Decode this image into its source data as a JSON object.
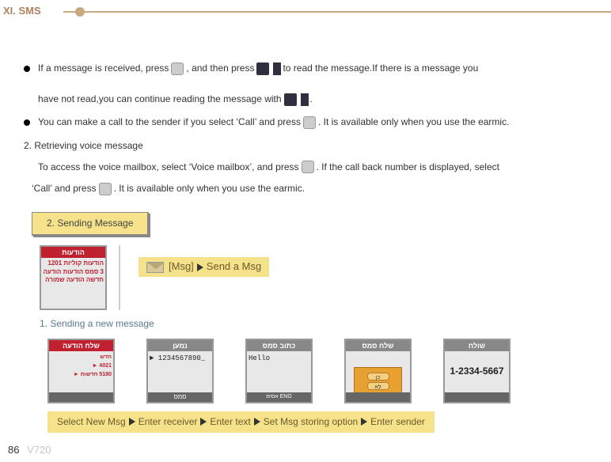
{
  "header": {
    "chapter": "XI. SMS"
  },
  "body": {
    "bullet1_a": "If a message is received, press ",
    "bullet1_b": " , and then press ",
    "bullet1_c": " to read the message.If there is a message you",
    "bullet1_cont_a": "have not read,you can continue reading the message with ",
    "bullet1_cont_b": " .",
    "bullet2_a": "You can make a call to the sender if you select ‘Call’ and press ",
    "bullet2_b": " . It is available only when you use the earmic.",
    "section2": "2. Retrieving voice message",
    "section2_line1_a": "To access the voice mailbox, select ‘Voice mailbox’, and press ",
    "section2_line1_b": " . If the call back number is displayed, select",
    "section2_line2_a": "‘Call’ and press ",
    "section2_line2_b": " . It is available only when you use the earmic.",
    "sending_box": "2. Sending Message",
    "breadcrumb": {
      "label1": "[Msg]",
      "label2": "Send a Msg"
    },
    "subsection1": "1. Sending a new message",
    "action_strip": {
      "s1": "Select New Msg",
      "s2": "Enter receiver",
      "s3": "Enter text",
      "s4": "Set Msg storing option",
      "s5": "Enter sender"
    },
    "phones": {
      "p1": {
        "title": "הודעות",
        "body": "הודעות קוליות 1201\n3 סמס הודעות\nהודעה חדשה\nהודעה שמורה"
      },
      "p2": {
        "title": "שלח הודעה",
        "body": "חדש\n4021  ► \n5180 חדשות  ► "
      },
      "p3": {
        "title": "נמען",
        "body": "► 1234567890_",
        "bottom": "סמס"
      },
      "p4": {
        "title": "כתוב סמס",
        "body": "Hello",
        "bottom": "אסימ ENG"
      },
      "p5": {
        "title": "שלח סמס",
        "overlay": true,
        "opt1": "כן",
        "opt2": "לא"
      },
      "p6": {
        "title": "שולח",
        "body": "1-2334-5667"
      }
    }
  },
  "footer": {
    "page": "86",
    "model": "V720"
  }
}
